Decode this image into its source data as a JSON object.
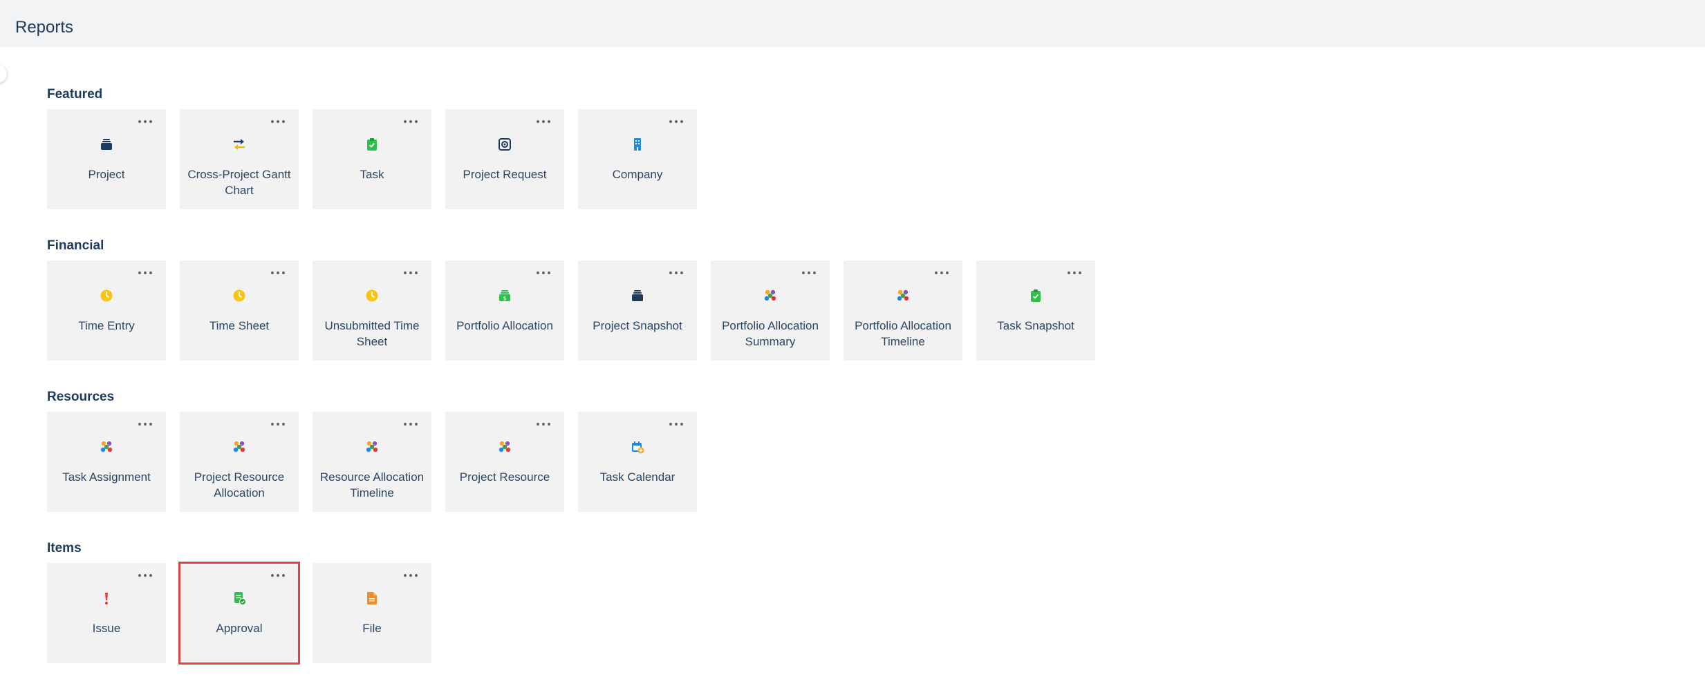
{
  "header": {
    "title": "Reports"
  },
  "sections": [
    {
      "title": "Featured",
      "tiles": [
        {
          "label": "Project",
          "icon": "project-stack-icon"
        },
        {
          "label": "Cross-Project Gantt Chart",
          "icon": "swap-arrows-icon"
        },
        {
          "label": "Task",
          "icon": "task-clipboard-icon"
        },
        {
          "label": "Project Request",
          "icon": "request-target-icon"
        },
        {
          "label": "Company",
          "icon": "building-icon"
        }
      ]
    },
    {
      "title": "Financial",
      "tiles": [
        {
          "label": "Time Entry",
          "icon": "clock-icon"
        },
        {
          "label": "Time Sheet",
          "icon": "clock-icon"
        },
        {
          "label": "Unsubmitted Time Sheet",
          "icon": "clock-icon"
        },
        {
          "label": "Portfolio Allocation",
          "icon": "money-stack-icon"
        },
        {
          "label": "Project Snapshot",
          "icon": "project-stack-icon"
        },
        {
          "label": "Portfolio Allocation Summary",
          "icon": "people-group-icon"
        },
        {
          "label": "Portfolio Allocation Timeline",
          "icon": "people-group-icon"
        },
        {
          "label": "Task Snapshot",
          "icon": "task-clipboard-icon"
        }
      ]
    },
    {
      "title": "Resources",
      "tiles": [
        {
          "label": "Task Assignment",
          "icon": "people-group-icon"
        },
        {
          "label": "Project Resource Allocation",
          "icon": "people-group-icon"
        },
        {
          "label": "Resource Allocation Timeline",
          "icon": "people-group-icon"
        },
        {
          "label": "Project Resource",
          "icon": "people-group-icon"
        },
        {
          "label": "Task Calendar",
          "icon": "calendar-icon"
        }
      ]
    },
    {
      "title": "Items",
      "tiles": [
        {
          "label": "Issue",
          "icon": "exclamation-icon"
        },
        {
          "label": "Approval",
          "icon": "approval-doc-icon",
          "selected": true
        },
        {
          "label": "File",
          "icon": "file-icon"
        }
      ]
    }
  ],
  "colors": {
    "title": "#1d3a5f",
    "tile_background": "#f2f2f2",
    "selection_outline": "#e04545"
  }
}
